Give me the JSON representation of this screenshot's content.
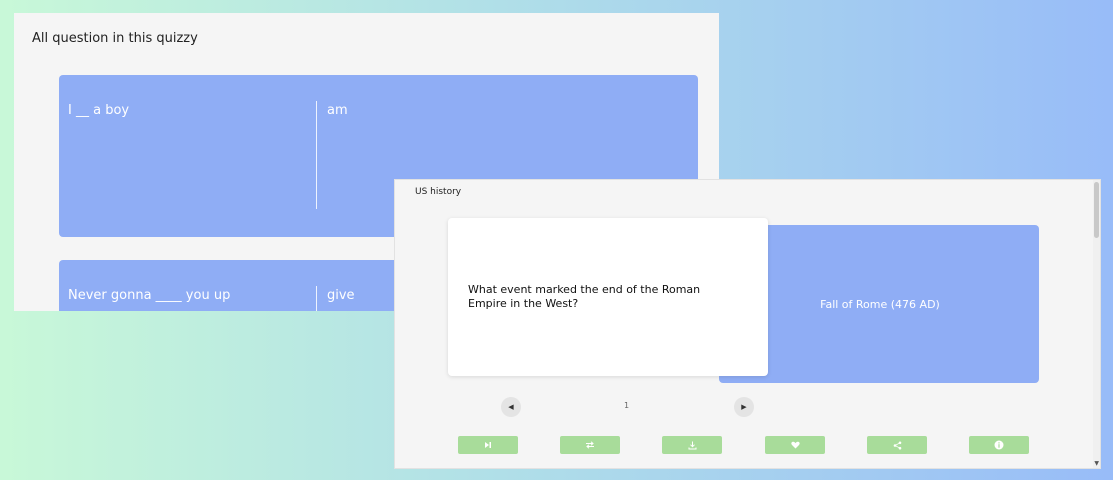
{
  "back_window": {
    "title": "All question in this quizzy",
    "cards": [
      {
        "question": "I __ a boy",
        "answer": "am"
      },
      {
        "question": "Never gonna ____ you up",
        "answer": "give"
      }
    ]
  },
  "front_window": {
    "title": "US history",
    "flashcard": {
      "question": "What event marked the end of the Roman Empire in the West?",
      "answer": "Fall of Rome (476 AD)"
    },
    "pagination": {
      "current": "1"
    },
    "actions": [
      {
        "name": "play-skip",
        "icon": "skip-icon"
      },
      {
        "name": "swap",
        "icon": "swap-icon"
      },
      {
        "name": "download",
        "icon": "download-icon"
      },
      {
        "name": "favorite",
        "icon": "heart-icon"
      },
      {
        "name": "share",
        "icon": "share-icon"
      },
      {
        "name": "info",
        "icon": "info-icon"
      }
    ]
  },
  "colors": {
    "card_blue": "#8fadf5",
    "action_green": "#a8dc9a",
    "panel_bg": "#f5f5f5"
  }
}
